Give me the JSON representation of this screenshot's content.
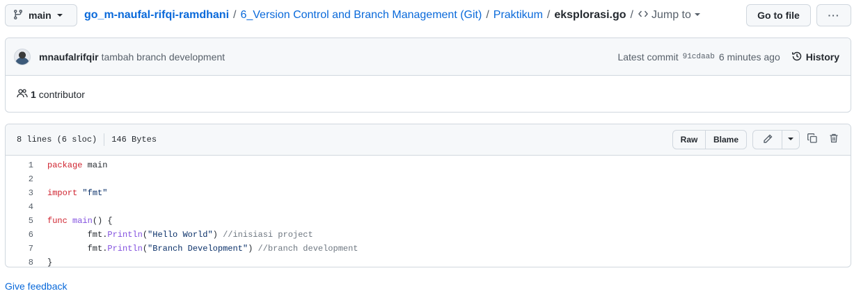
{
  "branch": {
    "name": "main"
  },
  "breadcrumb": {
    "repo": "go_m-naufal-rifqi-ramdhani",
    "folder1": "6_Version Control and Branch Management (Git)",
    "folder2": "Praktikum",
    "file": "eksplorasi.go",
    "separator": "/",
    "jump_to": "Jump to"
  },
  "toolbar": {
    "go_to_file": "Go to file",
    "more": "···"
  },
  "commit": {
    "author": "mnaufalrifqir",
    "message": "tambah branch development",
    "latest_label": "Latest commit",
    "sha": "91cdaab",
    "time": "6 minutes ago",
    "history_label": "History"
  },
  "contributors": {
    "count": "1",
    "label": "contributor"
  },
  "file_info": {
    "lines": "8 lines (6 sloc)",
    "size": "146 Bytes"
  },
  "file_actions": {
    "raw": "Raw",
    "blame": "Blame"
  },
  "code_lines": [
    {
      "num": "1",
      "tokens": [
        [
          "kw",
          "package"
        ],
        [
          "",
          " main"
        ]
      ]
    },
    {
      "num": "2",
      "tokens": []
    },
    {
      "num": "3",
      "tokens": [
        [
          "kw",
          "import"
        ],
        [
          "",
          " "
        ],
        [
          "str",
          "\"fmt\""
        ]
      ]
    },
    {
      "num": "4",
      "tokens": []
    },
    {
      "num": "5",
      "tokens": [
        [
          "kw",
          "func"
        ],
        [
          "",
          " "
        ],
        [
          "fn",
          "main"
        ],
        [
          "",
          "() {"
        ]
      ]
    },
    {
      "num": "6",
      "tokens": [
        [
          "",
          "\tfmt."
        ],
        [
          "fn",
          "Println"
        ],
        [
          "",
          "("
        ],
        [
          "str",
          "\"Hello World\""
        ],
        [
          "",
          ") "
        ],
        [
          "cm",
          "//inisiasi project"
        ]
      ]
    },
    {
      "num": "7",
      "tokens": [
        [
          "",
          "\tfmt."
        ],
        [
          "fn",
          "Println"
        ],
        [
          "",
          "("
        ],
        [
          "str",
          "\"Branch Development\""
        ],
        [
          "",
          ") "
        ],
        [
          "cm",
          "//branch development"
        ]
      ]
    },
    {
      "num": "8",
      "tokens": [
        [
          "",
          "}"
        ]
      ]
    }
  ],
  "footer": {
    "feedback": "Give feedback"
  },
  "colors": {
    "link": "#0969da",
    "keyword": "#cf222e",
    "function": "#8250df",
    "string": "#0a3069",
    "comment": "#6e7781"
  },
  "icons": [
    "git-branch-icon",
    "chevron-down-icon",
    "code-icon",
    "kebab-icon",
    "history-icon",
    "people-icon",
    "pencil-icon",
    "copy-icon",
    "trash-icon"
  ]
}
